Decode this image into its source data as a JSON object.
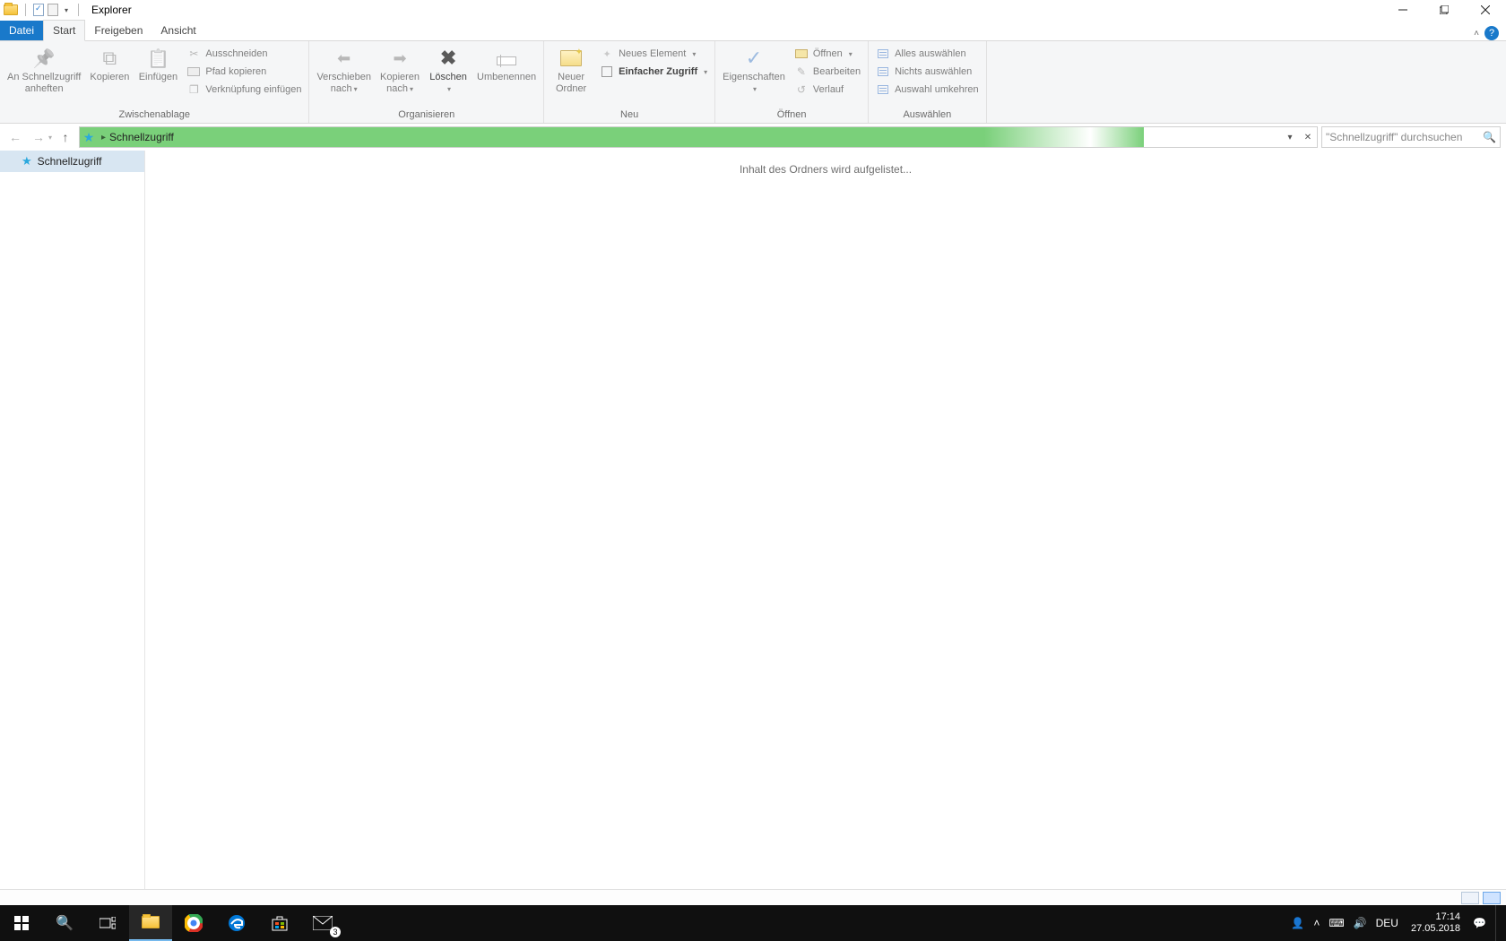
{
  "window": {
    "title": "Explorer"
  },
  "tabs": {
    "file": "Datei",
    "start": "Start",
    "share": "Freigeben",
    "view": "Ansicht"
  },
  "ribbon": {
    "clipboard": {
      "label": "Zwischenablage",
      "pin": "An Schnellzugriff\nanheften",
      "copy": "Kopieren",
      "paste": "Einfügen",
      "cut": "Ausschneiden",
      "copypath": "Pfad kopieren",
      "pastelink": "Verknüpfung einfügen"
    },
    "organize": {
      "label": "Organisieren",
      "moveto": "Verschieben\nnach",
      "copyto": "Kopieren\nnach",
      "delete": "Löschen",
      "rename": "Umbenennen"
    },
    "new": {
      "label": "Neu",
      "newfolder": "Neuer\nOrdner",
      "newitem": "Neues Element",
      "easyaccess": "Einfacher Zugriff"
    },
    "open": {
      "label": "Öffnen",
      "properties": "Eigenschaften",
      "open": "Öffnen",
      "edit": "Bearbeiten",
      "history": "Verlauf"
    },
    "select": {
      "label": "Auswählen",
      "all": "Alles auswählen",
      "none": "Nichts auswählen",
      "invert": "Auswahl umkehren"
    }
  },
  "address": {
    "location": "Schnellzugriff"
  },
  "search": {
    "placeholder": "\"Schnellzugriff\" durchsuchen"
  },
  "tree": {
    "quickaccess": "Schnellzugriff"
  },
  "content": {
    "loading": "Inhalt des Ordners wird aufgelistet..."
  },
  "tray": {
    "lang": "DEU",
    "time": "17:14",
    "date": "27.05.2018",
    "mailbadge": "3"
  }
}
